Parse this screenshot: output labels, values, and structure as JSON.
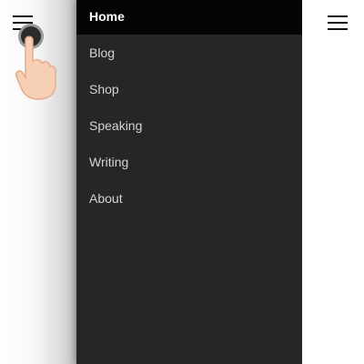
{
  "menu": {
    "items": [
      {
        "label": "Home",
        "active": true
      },
      {
        "label": "Blog",
        "active": false
      },
      {
        "label": "Shop",
        "active": false
      },
      {
        "label": "Speaking",
        "active": false
      },
      {
        "label": "Writing",
        "active": false
      },
      {
        "label": "About",
        "active": false
      }
    ]
  },
  "icons": {
    "left_menu": "hamburger-icon",
    "right_menu": "hamburger-icon",
    "gesture": "tap-finger-icon"
  },
  "colors": {
    "menu_background": "#262626",
    "active_item_background": "#050505",
    "item_text": "#d4d4d4",
    "active_item_text": "#ffffff"
  }
}
